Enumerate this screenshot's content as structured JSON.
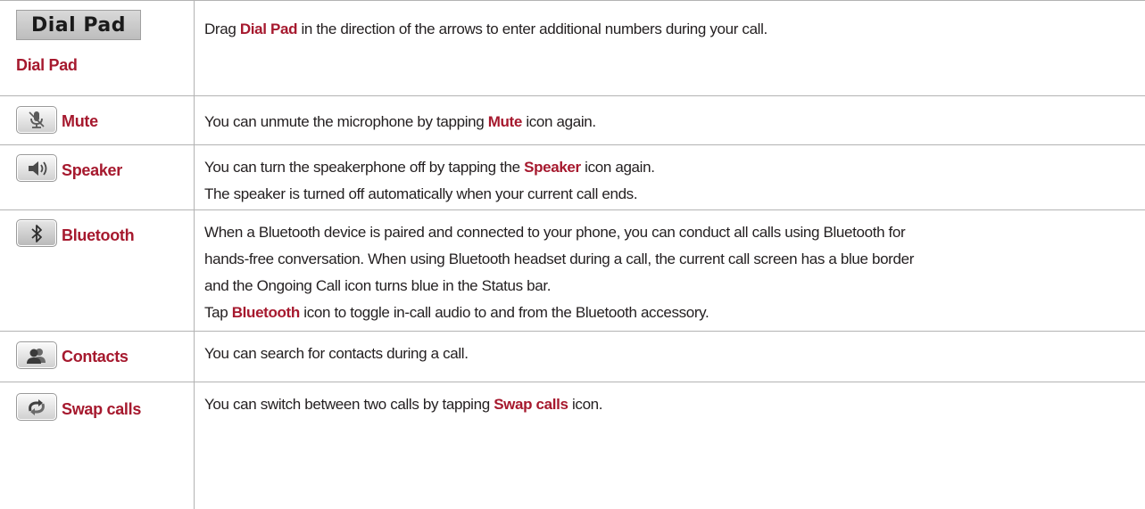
{
  "rows": [
    {
      "label": "Dial Pad",
      "icon": "dial-pad-icon",
      "icon_text": "Dial Pad",
      "lines": [
        {
          "a": "Drag ",
          "b": "Dial Pad",
          "c": " in the direction of the arrows to enter additional numbers during your call."
        }
      ]
    },
    {
      "label": "Mute",
      "icon": "microphone-muted-icon",
      "lines": [
        {
          "a": "You can unmute the microphone by tapping ",
          "b": "Mute",
          "c": " icon again."
        }
      ]
    },
    {
      "label": "Speaker",
      "icon": "speaker-icon",
      "lines": [
        {
          "a": "You can turn the speakerphone off by tapping the ",
          "b": "Speaker",
          "c": " icon again."
        },
        {
          "a": "The speaker is turned off automatically when your current call ends."
        }
      ]
    },
    {
      "label": "Bluetooth",
      "icon": "bluetooth-icon",
      "lines": [
        {
          "a": "When a Bluetooth device is paired and connected to your phone, you can conduct all calls using Bluetooth for"
        },
        {
          "a": "hands-free conversation. When using Bluetooth headset during a call, the current call screen has a blue border"
        },
        {
          "a": "and the Ongoing Call icon turns blue in the Status bar."
        },
        {
          "a": "Tap ",
          "b": "Bluetooth",
          "c": " icon to toggle in-call audio to and from the Bluetooth accessory."
        }
      ]
    },
    {
      "label": "Contacts",
      "icon": "contacts-icon",
      "lines": [
        {
          "a": "You can search for contacts during a call."
        }
      ]
    },
    {
      "label": "Swap calls",
      "icon": "swap-calls-icon",
      "lines": [
        {
          "a": "You can switch between two calls by tapping ",
          "b": "Swap calls",
          "c": " icon."
        }
      ]
    }
  ],
  "colors": {
    "highlight": "#a6192e",
    "text": "#231f20",
    "rule": "#b3b3b3"
  }
}
